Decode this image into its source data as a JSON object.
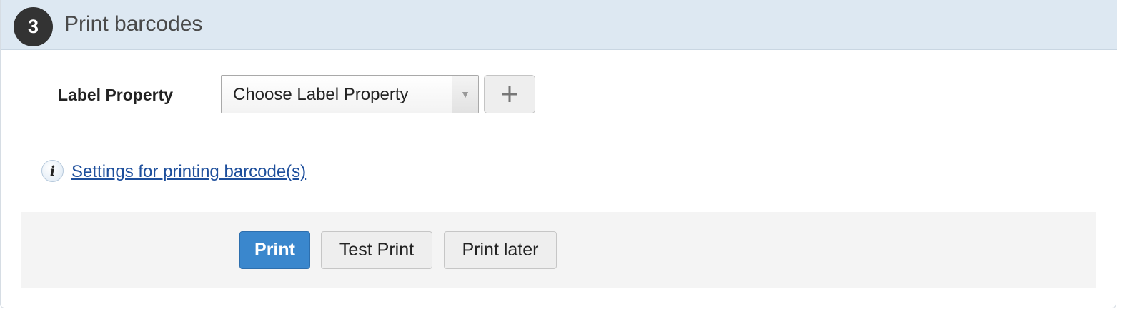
{
  "header": {
    "step_number": "3",
    "title": "Print barcodes"
  },
  "form": {
    "label_property_label": "Label Property",
    "label_property_select": {
      "selected_value": "Choose Label Property"
    },
    "add_button_label": "+"
  },
  "info": {
    "icon": "info-icon",
    "settings_link_text": "Settings for printing barcode(s)"
  },
  "actions": {
    "print_label": "Print",
    "test_print_label": "Test Print",
    "print_later_label": "Print later"
  },
  "colors": {
    "header_background": "#dde8f2",
    "primary_button": "#3a87cd",
    "link": "#1e4f9c"
  }
}
